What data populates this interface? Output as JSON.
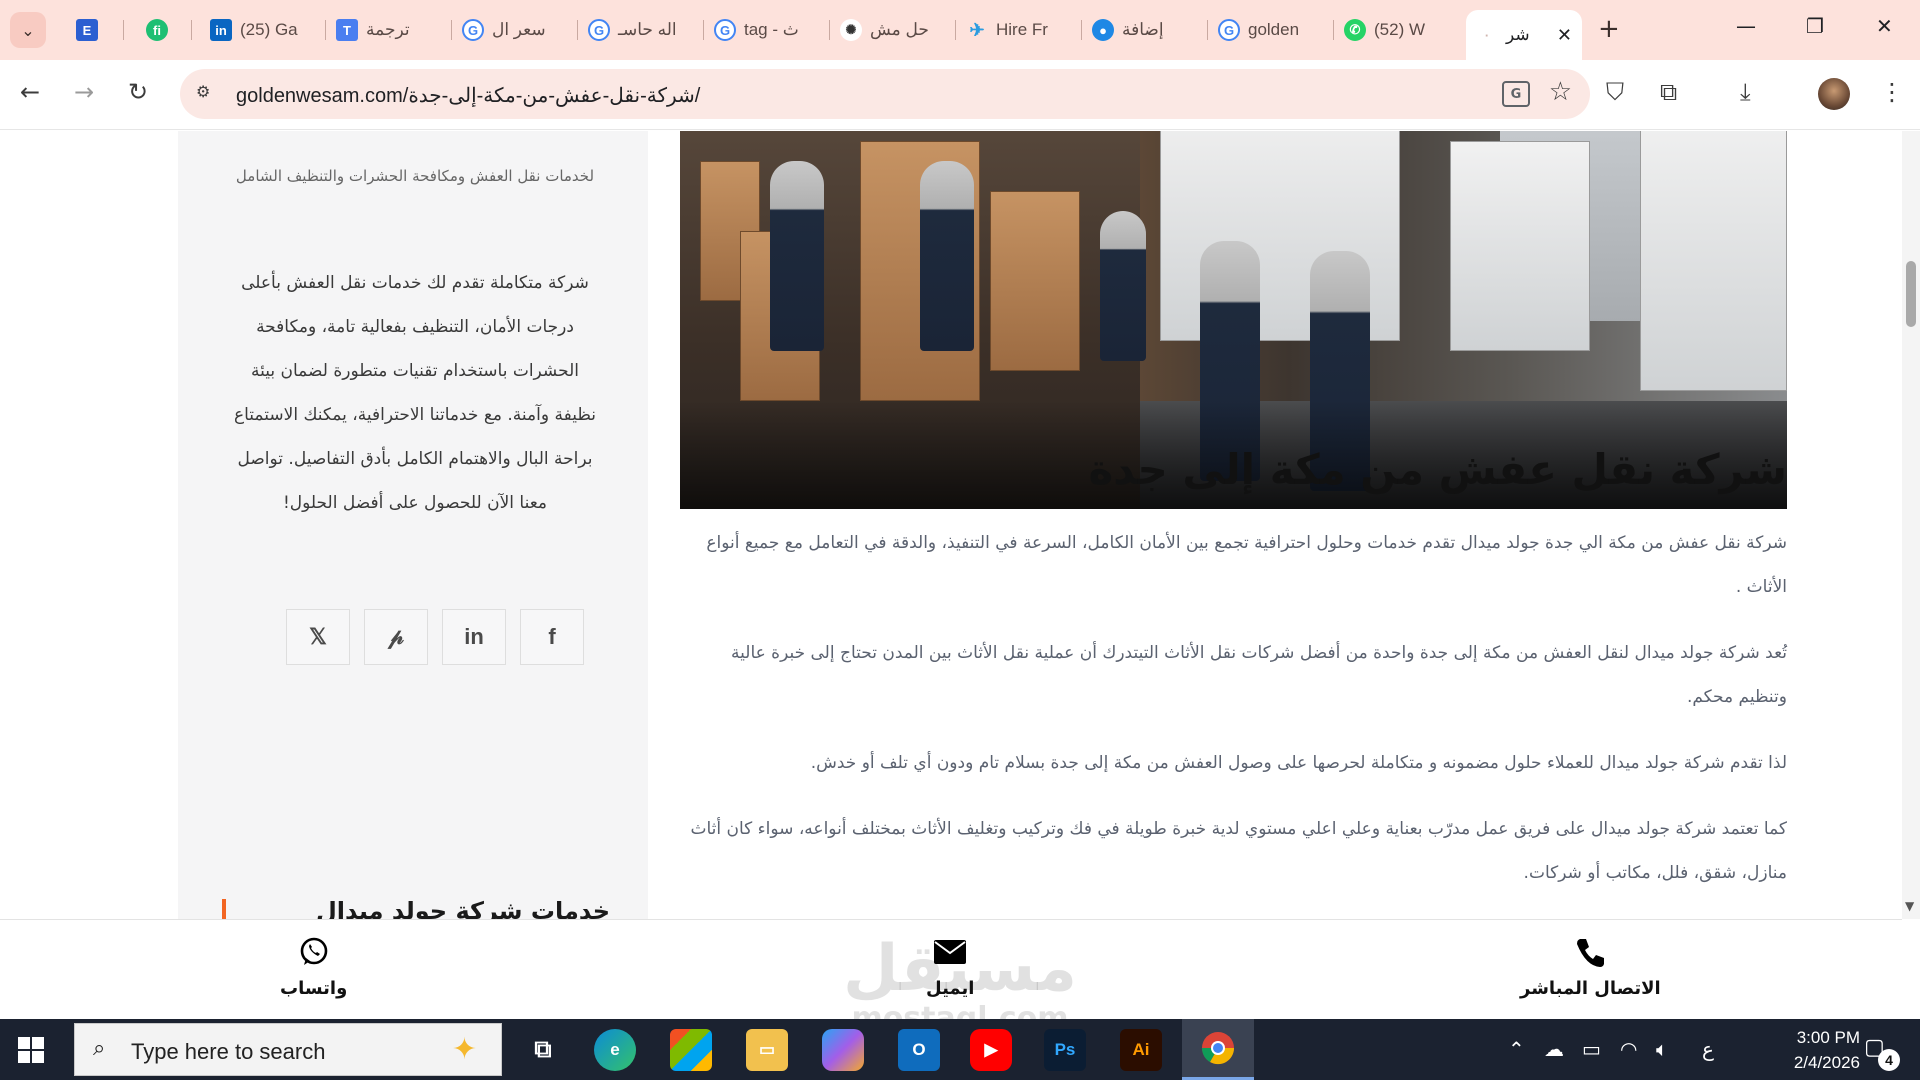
{
  "browser": {
    "tabs": [
      {
        "title": "",
        "favicon": "E",
        "color": "#2b5fd1"
      },
      {
        "title": "",
        "favicon": "fi",
        "color": "#1dbf73"
      },
      {
        "title": "(25) Ga",
        "favicon": "in",
        "color": "#0a66c2"
      },
      {
        "title": "ترجمة",
        "favicon": "T",
        "color": "#4a7ef0"
      },
      {
        "title": "سعر ال",
        "favicon": "G",
        "color": "#4285f4"
      },
      {
        "title": "اله حاسـ",
        "favicon": "G",
        "color": "#4285f4"
      },
      {
        "title": "tag - ث",
        "favicon": "G",
        "color": "#4285f4"
      },
      {
        "title": "حل مش",
        "favicon": "✺",
        "color": "#333333"
      },
      {
        "title": "Hire Fr",
        "favicon": "✈",
        "color": "#2b9ce0"
      },
      {
        "title": "إضافة",
        "favicon": "●",
        "color": "#1e88e5"
      },
      {
        "title": "golden",
        "favicon": "G",
        "color": "#4285f4"
      },
      {
        "title": "(52) W",
        "favicon": "✆",
        "color": "#25d366"
      },
      {
        "title": "شر",
        "favicon": "·",
        "color": "#d0b5ae"
      }
    ],
    "new_tab": "+",
    "url": "goldenwesam.com/شركة-نقل-عفش-من-مكة-إلى-جدة/"
  },
  "sidebar": {
    "tagline": "لخدمات نقل العفش ومكافحة الحشرات والتنظيف الشامل",
    "about": "شركة متكاملة تقدم لك خدمات نقل العفش بأعلى درجات الأمان، التنظيف بفعالية تامة، ومكافحة الحشرات باستخدام تقنيات متطورة لضمان بيئة نظيفة وآمنة. مع خدماتنا الاحترافية، يمكنك الاستمتاع براحة البال والاهتمام الكامل بأدق التفاصيل. تواصل معنا الآن للحصول على أفضل الحلول!",
    "socials": [
      "x-icon",
      "pinterest-icon",
      "linkedin-icon",
      "facebook-icon"
    ],
    "services_heading": "خدمات شركة جولد ميدال"
  },
  "article": {
    "title": "شركة نقل عفش من مكة إلى جدة",
    "p1": "شركة نقل عفش من مكة الي جدة جولد ميدال تقدم خدمات وحلول احترافية تجمع بين الأمان الكامل، السرعة في التنفيذ، والدقة في التعامل مع جميع أنواع الأثاث .",
    "p2": "تُعد شركة جولد ميدال لنقل العفش من مكة إلى جدة واحدة من أفضل شركات نقل الأثاث التيتدرك أن عملية نقل الأثاث بين المدن تحتاج إلى خبرة عالية وتنظيم محكم.",
    "p3": "لذا تقدم شركة جولد ميدال للعملاء حلول مضمونه و متكاملة لحرصها على وصول العفش من مكة إلى جدة بسلام تام ودون أي تلف أو خدش.",
    "p4": "كما تعتمد شركة جولد ميدال على فريق عمل مدرّب بعناية وعلي اعلي مستوي لدية خبرة طويلة في فك وتركيب وتغليف الأثاث بمختلف أنواعه، سواء كان أثاث منازل، شقق، فلل، مكاتب أو شركات."
  },
  "contact_bar": {
    "whatsapp": "واتساب",
    "email": "ايميل",
    "call": "الاتصال المباشر",
    "watermark_ar": "مستقل",
    "watermark_en": "mostaql.com"
  },
  "taskbar": {
    "search_placeholder": "Type here to search",
    "time": "3:00 PM",
    "date": "2/4/2026",
    "lang": "ع",
    "notifications": "4"
  }
}
